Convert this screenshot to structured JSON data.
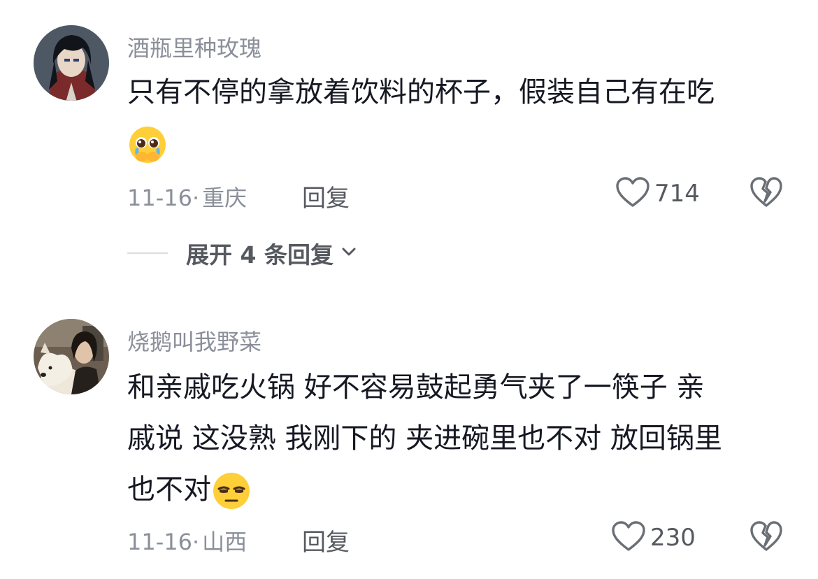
{
  "comments": [
    {
      "username": "酒瓶里种玫瑰",
      "text_lines": [
        "只有不停的拿放着饮料的杯子，假装自己有在吃"
      ],
      "emoji": "pleading-face-emoji",
      "date": "11-16",
      "separator": "·",
      "location": "重庆",
      "reply_label": "回复",
      "like_count": "714",
      "expand_label": "展开 4 条回复"
    },
    {
      "username": "烧鹅叫我野菜",
      "text_lines": [
        "和亲戚吃火锅 好不容易鼓起勇气夹了一筷子 亲",
        "戚说 这没熟 我刚下的 夹进碗里也不对 放回锅里",
        "也不对"
      ],
      "emoji": "unamused-face-emoji",
      "date": "11-16",
      "separator": "·",
      "location": "山西",
      "reply_label": "回复",
      "like_count": "230"
    }
  ],
  "icons": {
    "like": "heart-outline-icon",
    "dislike": "broken-heart-icon",
    "expand": "chevron-down-icon"
  },
  "colors": {
    "text_primary": "#161823",
    "text_secondary": "#8a8f99",
    "action": "#55595f"
  }
}
